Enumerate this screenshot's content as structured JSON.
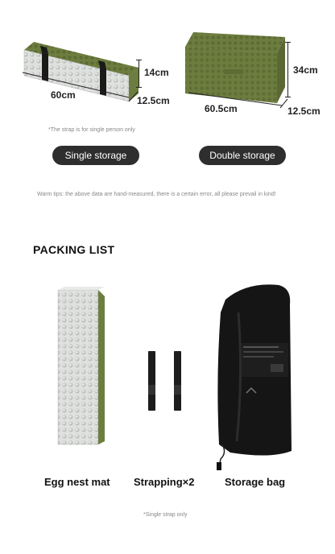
{
  "single": {
    "length": "60cm",
    "height": "14cm",
    "depth": "12.5cm",
    "note": "*The strap is for single person only",
    "button_label": "Single storage"
  },
  "double": {
    "length": "60.5cm",
    "height": "34cm",
    "depth": "12.5cm",
    "button_label": "Double storage"
  },
  "warm_tips": "Warm tips: the above data are hand-measured, there is a certain error, all please prevail in kind!",
  "packing": {
    "heading": "PACKING LIST",
    "items": [
      "Egg nest mat",
      "Strapping×2",
      "Storage bag"
    ],
    "footnote": "*Single strap only"
  },
  "colors": {
    "mat_green": "#6d7d3f",
    "foil_silver": "#d8dad8",
    "button_dark": "#2e2e2e",
    "bag_black": "#151515"
  }
}
